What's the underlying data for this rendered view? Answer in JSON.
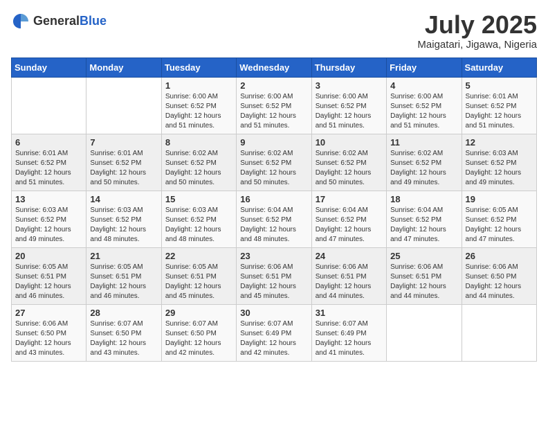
{
  "logo": {
    "general": "General",
    "blue": "Blue"
  },
  "title": {
    "month_year": "July 2025",
    "location": "Maigatari, Jigawa, Nigeria"
  },
  "days_of_week": [
    "Sunday",
    "Monday",
    "Tuesday",
    "Wednesday",
    "Thursday",
    "Friday",
    "Saturday"
  ],
  "weeks": [
    [
      {
        "day": "",
        "info": ""
      },
      {
        "day": "",
        "info": ""
      },
      {
        "day": "1",
        "info": "Sunrise: 6:00 AM\nSunset: 6:52 PM\nDaylight: 12 hours and 51 minutes."
      },
      {
        "day": "2",
        "info": "Sunrise: 6:00 AM\nSunset: 6:52 PM\nDaylight: 12 hours and 51 minutes."
      },
      {
        "day": "3",
        "info": "Sunrise: 6:00 AM\nSunset: 6:52 PM\nDaylight: 12 hours and 51 minutes."
      },
      {
        "day": "4",
        "info": "Sunrise: 6:00 AM\nSunset: 6:52 PM\nDaylight: 12 hours and 51 minutes."
      },
      {
        "day": "5",
        "info": "Sunrise: 6:01 AM\nSunset: 6:52 PM\nDaylight: 12 hours and 51 minutes."
      }
    ],
    [
      {
        "day": "6",
        "info": "Sunrise: 6:01 AM\nSunset: 6:52 PM\nDaylight: 12 hours and 51 minutes."
      },
      {
        "day": "7",
        "info": "Sunrise: 6:01 AM\nSunset: 6:52 PM\nDaylight: 12 hours and 50 minutes."
      },
      {
        "day": "8",
        "info": "Sunrise: 6:02 AM\nSunset: 6:52 PM\nDaylight: 12 hours and 50 minutes."
      },
      {
        "day": "9",
        "info": "Sunrise: 6:02 AM\nSunset: 6:52 PM\nDaylight: 12 hours and 50 minutes."
      },
      {
        "day": "10",
        "info": "Sunrise: 6:02 AM\nSunset: 6:52 PM\nDaylight: 12 hours and 50 minutes."
      },
      {
        "day": "11",
        "info": "Sunrise: 6:02 AM\nSunset: 6:52 PM\nDaylight: 12 hours and 49 minutes."
      },
      {
        "day": "12",
        "info": "Sunrise: 6:03 AM\nSunset: 6:52 PM\nDaylight: 12 hours and 49 minutes."
      }
    ],
    [
      {
        "day": "13",
        "info": "Sunrise: 6:03 AM\nSunset: 6:52 PM\nDaylight: 12 hours and 49 minutes."
      },
      {
        "day": "14",
        "info": "Sunrise: 6:03 AM\nSunset: 6:52 PM\nDaylight: 12 hours and 48 minutes."
      },
      {
        "day": "15",
        "info": "Sunrise: 6:03 AM\nSunset: 6:52 PM\nDaylight: 12 hours and 48 minutes."
      },
      {
        "day": "16",
        "info": "Sunrise: 6:04 AM\nSunset: 6:52 PM\nDaylight: 12 hours and 48 minutes."
      },
      {
        "day": "17",
        "info": "Sunrise: 6:04 AM\nSunset: 6:52 PM\nDaylight: 12 hours and 47 minutes."
      },
      {
        "day": "18",
        "info": "Sunrise: 6:04 AM\nSunset: 6:52 PM\nDaylight: 12 hours and 47 minutes."
      },
      {
        "day": "19",
        "info": "Sunrise: 6:05 AM\nSunset: 6:52 PM\nDaylight: 12 hours and 47 minutes."
      }
    ],
    [
      {
        "day": "20",
        "info": "Sunrise: 6:05 AM\nSunset: 6:51 PM\nDaylight: 12 hours and 46 minutes."
      },
      {
        "day": "21",
        "info": "Sunrise: 6:05 AM\nSunset: 6:51 PM\nDaylight: 12 hours and 46 minutes."
      },
      {
        "day": "22",
        "info": "Sunrise: 6:05 AM\nSunset: 6:51 PM\nDaylight: 12 hours and 45 minutes."
      },
      {
        "day": "23",
        "info": "Sunrise: 6:06 AM\nSunset: 6:51 PM\nDaylight: 12 hours and 45 minutes."
      },
      {
        "day": "24",
        "info": "Sunrise: 6:06 AM\nSunset: 6:51 PM\nDaylight: 12 hours and 44 minutes."
      },
      {
        "day": "25",
        "info": "Sunrise: 6:06 AM\nSunset: 6:51 PM\nDaylight: 12 hours and 44 minutes."
      },
      {
        "day": "26",
        "info": "Sunrise: 6:06 AM\nSunset: 6:50 PM\nDaylight: 12 hours and 44 minutes."
      }
    ],
    [
      {
        "day": "27",
        "info": "Sunrise: 6:06 AM\nSunset: 6:50 PM\nDaylight: 12 hours and 43 minutes."
      },
      {
        "day": "28",
        "info": "Sunrise: 6:07 AM\nSunset: 6:50 PM\nDaylight: 12 hours and 43 minutes."
      },
      {
        "day": "29",
        "info": "Sunrise: 6:07 AM\nSunset: 6:50 PM\nDaylight: 12 hours and 42 minutes."
      },
      {
        "day": "30",
        "info": "Sunrise: 6:07 AM\nSunset: 6:49 PM\nDaylight: 12 hours and 42 minutes."
      },
      {
        "day": "31",
        "info": "Sunrise: 6:07 AM\nSunset: 6:49 PM\nDaylight: 12 hours and 41 minutes."
      },
      {
        "day": "",
        "info": ""
      },
      {
        "day": "",
        "info": ""
      }
    ]
  ]
}
